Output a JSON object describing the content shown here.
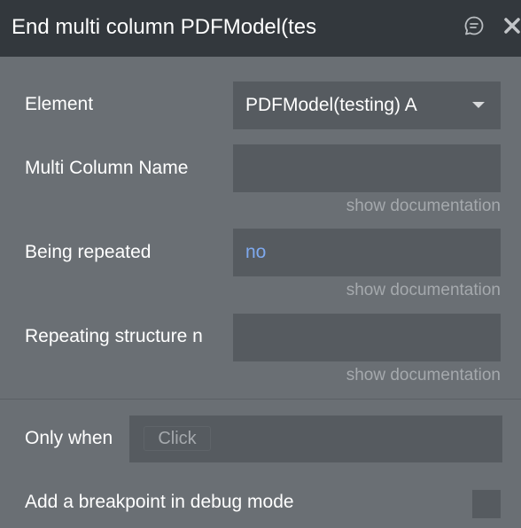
{
  "header": {
    "title": "End multi column PDFModel(tes",
    "icons": [
      "comment-icon",
      "close-icon"
    ]
  },
  "fields": {
    "element": {
      "label": "Element",
      "value": "PDFModel(testing) A"
    },
    "multi_column_name": {
      "label": "Multi Column Name",
      "value": "",
      "doc_link": "show documentation"
    },
    "being_repeated": {
      "label": "Being repeated",
      "value": "no",
      "doc_link": "show documentation"
    },
    "repeating_structure": {
      "label": "Repeating structure n",
      "value": "",
      "doc_link": "show documentation"
    }
  },
  "condition": {
    "label": "Only when",
    "placeholder": "Click"
  },
  "breakpoint": {
    "label": "Add a breakpoint in debug mode",
    "checked": false
  },
  "colors": {
    "header_bg": "#33383d",
    "panel_bg": "#6a6f74",
    "input_bg": "#565b60",
    "link_value": "#7ea9ee",
    "muted_text": "#a5a9ad"
  }
}
